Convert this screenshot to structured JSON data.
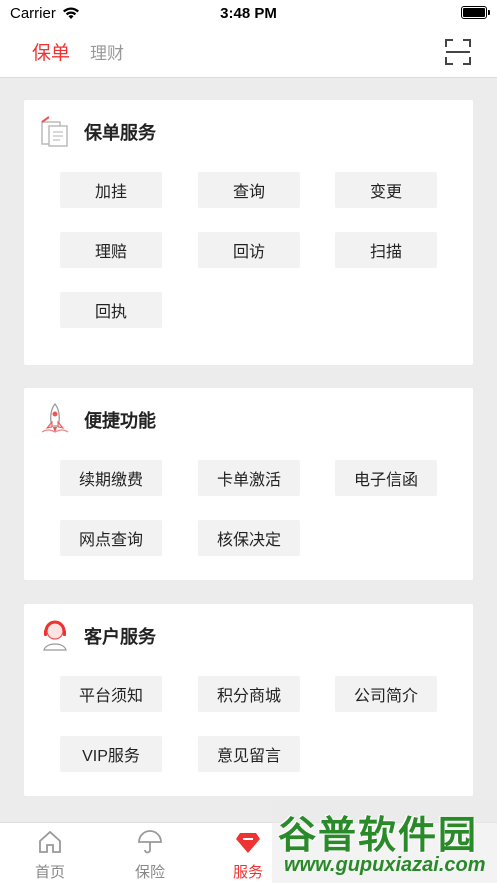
{
  "status_bar": {
    "carrier": "Carrier",
    "time": "3:48 PM"
  },
  "top_nav": {
    "tabs": [
      {
        "label": "保单",
        "active": true
      },
      {
        "label": "理财",
        "active": false
      }
    ],
    "scan_icon": "scan-icon"
  },
  "sections": [
    {
      "title": "保单服务",
      "icon": "policy-document-icon",
      "buttons": [
        "加挂",
        "查询",
        "变更",
        "理赔",
        "回访",
        "扫描",
        "回执"
      ]
    },
    {
      "title": "便捷功能",
      "icon": "rocket-icon",
      "buttons": [
        "续期缴费",
        "卡单激活",
        "电子信函",
        "网点查询",
        "核保决定"
      ]
    },
    {
      "title": "客户服务",
      "icon": "customer-service-icon",
      "buttons": [
        "平台须知",
        "积分商城",
        "公司简介",
        "VIP服务",
        "意见留言"
      ]
    }
  ],
  "tab_bar": {
    "items": [
      {
        "label": "首页",
        "icon": "home-icon",
        "active": false
      },
      {
        "label": "保险",
        "icon": "umbrella-icon",
        "active": false
      },
      {
        "label": "服务",
        "icon": "service-diamond-icon",
        "active": true
      }
    ]
  },
  "watermark": {
    "title": "谷普软件园",
    "url": "www.gupuxiazai.com"
  },
  "colors": {
    "accent": "#ee3333",
    "button_bg": "#f2f2f2",
    "page_bg": "#ececec"
  }
}
